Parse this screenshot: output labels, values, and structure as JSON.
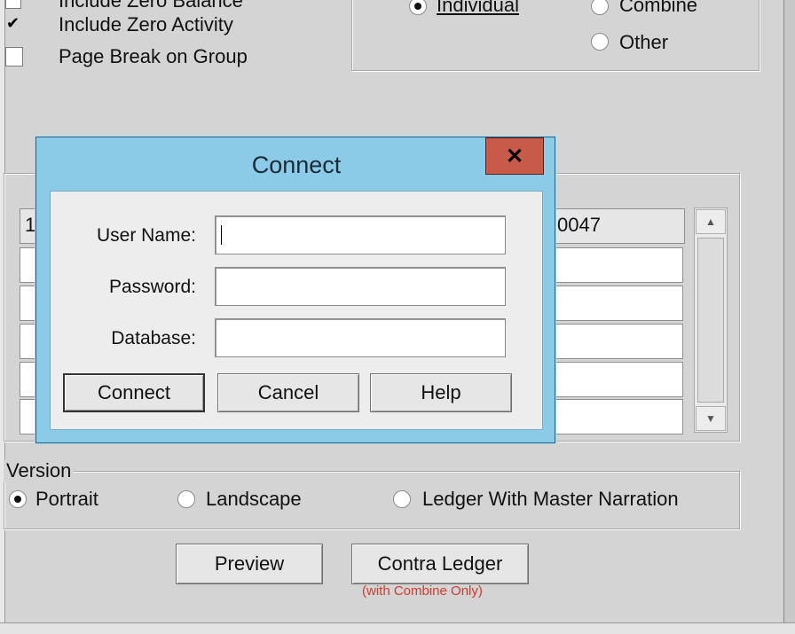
{
  "options": {
    "include_zero_balance": {
      "label": "Include Zero Balance",
      "checked": false
    },
    "include_zero_activity": {
      "label": "Include Zero Activity",
      "checked": true
    },
    "page_break_on_group": {
      "label": "Page Break on Group",
      "checked": false
    }
  },
  "ledger_mode": {
    "individual": {
      "label": "Individual",
      "selected": true
    },
    "combine": {
      "label": "Combine",
      "selected": false
    },
    "other": {
      "label": "Other",
      "selected": false
    }
  },
  "grid": {
    "first_row_left": "1",
    "first_row_right": "0047"
  },
  "version": {
    "legend": "Version",
    "portrait": {
      "label": "Portrait",
      "selected": true
    },
    "landscape": {
      "label": "Landscape",
      "selected": false
    },
    "ledger_master": {
      "label": "Ledger With Master Narration",
      "selected": false
    }
  },
  "actions": {
    "preview": "Preview",
    "contra_ledger": "Contra Ledger",
    "contra_note": "(with Combine Only)"
  },
  "dialog": {
    "title": "Connect",
    "close_glyph": "✕",
    "user_name_label": "User Name:",
    "password_label": "Password:",
    "database_label": "Database:",
    "user_name_value": "",
    "password_value": "",
    "database_value": "",
    "connect": "Connect",
    "cancel": "Cancel",
    "help": "Help"
  },
  "icons": [
    "checkmark-icon",
    "radio-dot-icon",
    "scroll-up-arrow-icon",
    "scroll-down-arrow-icon",
    "close-icon"
  ]
}
